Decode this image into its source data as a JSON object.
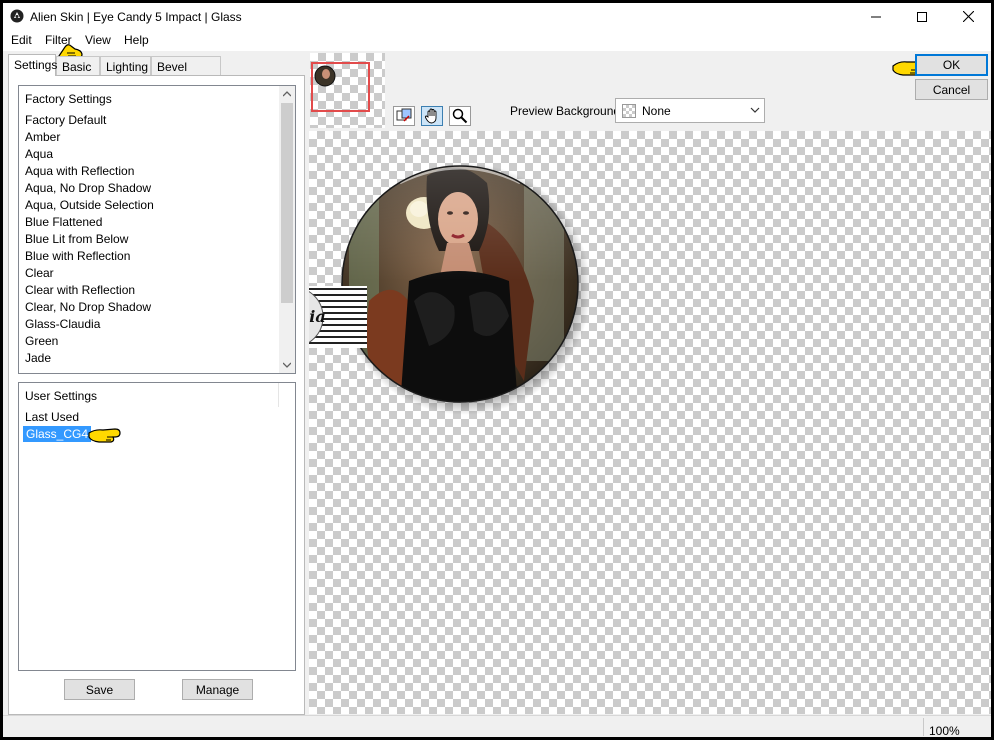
{
  "window": {
    "title": "Alien Skin | Eye Candy 5 Impact | Glass"
  },
  "menu": [
    "Edit",
    "Filter",
    "View",
    "Help"
  ],
  "tabs": [
    "Settings",
    "Basic",
    "Lighting",
    "Bevel Profile"
  ],
  "factory_settings": {
    "header": "Factory Settings",
    "items": [
      "Factory Default",
      "Amber",
      "Aqua",
      "Aqua with Reflection",
      "Aqua, No Drop Shadow",
      "Aqua, Outside Selection",
      "Blue Flattened",
      "Blue Lit from Below",
      "Blue with Reflection",
      "Clear",
      "Clear with Reflection",
      "Clear, No Drop Shadow",
      "Glass-Claudia",
      "Green",
      "Jade"
    ]
  },
  "user_settings": {
    "header": "User Settings",
    "items": [
      "Last Used",
      "Glass_CG4"
    ],
    "selected": "Glass_CG4"
  },
  "buttons": {
    "save": "Save",
    "manage": "Manage",
    "ok": "OK",
    "cancel": "Cancel"
  },
  "preview_background": {
    "label": "Preview Background:",
    "value": "None"
  },
  "watermark": {
    "text": "claudia"
  },
  "status": {
    "zoom": "100%"
  },
  "colors": {
    "accent": "#0078d7",
    "selection": "#3399ff",
    "pointer": "#ffd800",
    "thumb_frame": "#e24b4b"
  },
  "icons": [
    "app-logo-icon",
    "minimize-icon",
    "maximize-icon",
    "close-icon",
    "preview-mode-icon",
    "hand-tool-icon",
    "zoom-tool-icon",
    "chevron-down-icon",
    "pointing-hand-icon"
  ]
}
